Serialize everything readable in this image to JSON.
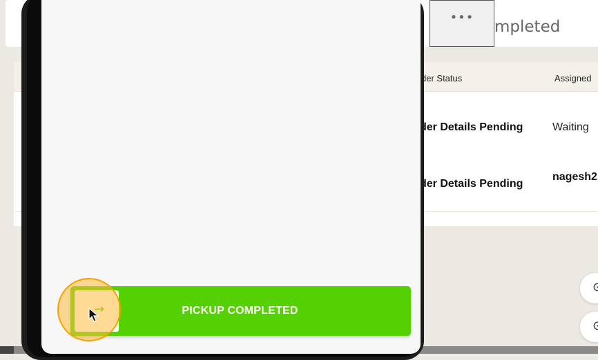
{
  "header": {
    "menu_icon": "more-dots-icon",
    "menu_label": "•••",
    "status_filter_text": "mpleted"
  },
  "table": {
    "columns": [
      "der Status",
      "Assigned"
    ],
    "rows": [
      {
        "order_status": "der Details Pending",
        "assigned": "Waiting"
      },
      {
        "order_status": "der Details Pending",
        "assigned": "nagesh2"
      }
    ]
  },
  "phone": {
    "slider": {
      "label": "PICKUP COMPLETED",
      "handle_icon": "arrow-right-icon",
      "handle_glyph": "→",
      "accent_color": "#55d000"
    }
  },
  "floating": {
    "icons": [
      "circle-icon",
      "circle-icon"
    ]
  },
  "overlay": {
    "click_highlight_color": "#f3a200"
  }
}
